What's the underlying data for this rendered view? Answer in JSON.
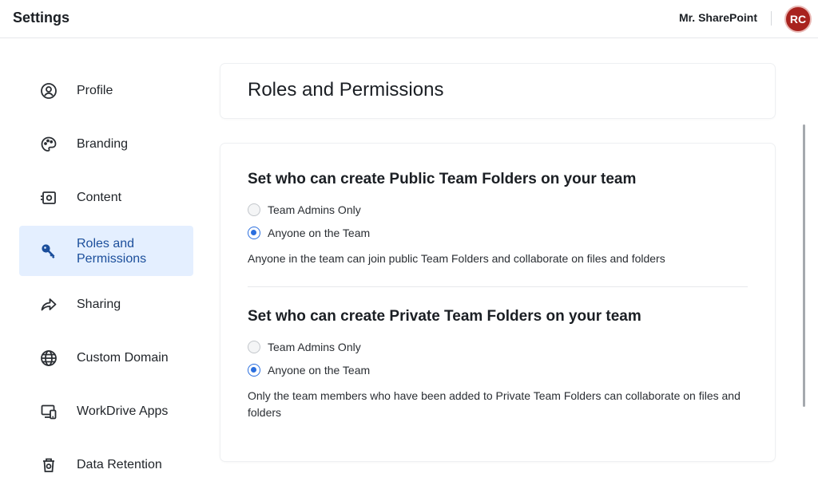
{
  "header": {
    "title": "Settings",
    "user_name": "Mr. SharePoint",
    "avatar_initials": "RC"
  },
  "sidebar": {
    "items": [
      {
        "label": "Profile",
        "icon": "profile-icon"
      },
      {
        "label": "Branding",
        "icon": "palette-icon"
      },
      {
        "label": "Content",
        "icon": "content-icon"
      },
      {
        "label": "Roles and Permissions",
        "icon": "key-icon",
        "active": true
      },
      {
        "label": "Sharing",
        "icon": "share-icon"
      },
      {
        "label": "Custom Domain",
        "icon": "globe-icon"
      },
      {
        "label": "WorkDrive Apps",
        "icon": "devices-icon"
      },
      {
        "label": "Data Retention",
        "icon": "trash-icon"
      }
    ]
  },
  "main": {
    "page_title": "Roles and Permissions",
    "sections": [
      {
        "heading": "Set who can create Public Team Folders on your team",
        "options": [
          {
            "label": "Team Admins Only",
            "checked": false
          },
          {
            "label": "Anyone on the Team",
            "checked": true
          }
        ],
        "help": "Anyone in the team can join public Team Folders and collaborate on files and folders"
      },
      {
        "heading": "Set who can create Private Team Folders on your team",
        "options": [
          {
            "label": "Team Admins Only",
            "checked": false
          },
          {
            "label": "Anyone on the Team",
            "checked": true
          }
        ],
        "help": "Only the team members who have been added to Private Team Folders can collaborate on files and folders"
      }
    ]
  },
  "colors": {
    "accent": "#2b6fde",
    "active_bg": "#e4efff",
    "avatar_bg": "#a8231e"
  }
}
